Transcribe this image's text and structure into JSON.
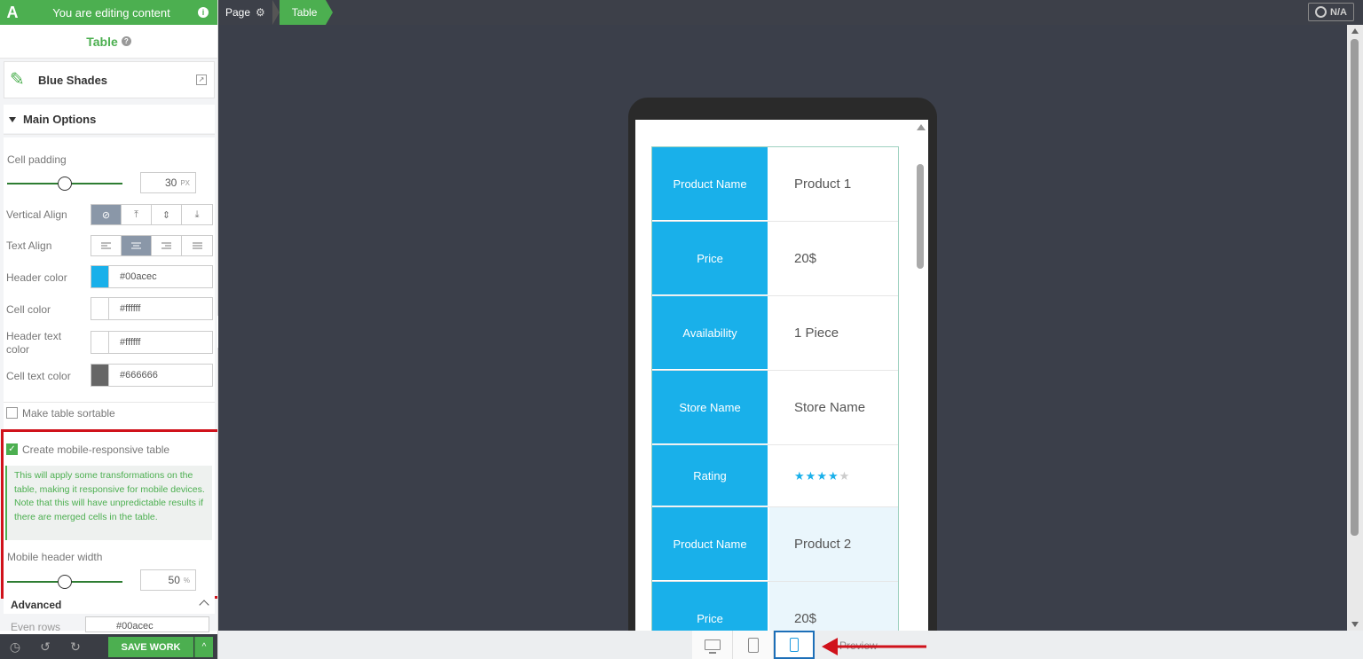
{
  "header": {
    "logo_letter": "A",
    "editing_label": "You are editing content",
    "info_icon": "info-icon"
  },
  "panel": {
    "title": "Table",
    "preset_name": "Blue Shades",
    "main_options_label": "Main Options",
    "cell_padding": {
      "label": "Cell padding",
      "value": "30",
      "unit": "PX",
      "slider_fraction": 0.5
    },
    "vertical_align": {
      "label": "Vertical Align",
      "options": [
        "⊘",
        "⤒",
        "⇕",
        "⤓"
      ],
      "active_index": 0
    },
    "text_align": {
      "label": "Text Align",
      "options": [
        "left",
        "center",
        "right",
        "justify"
      ],
      "active_index": 1
    },
    "header_color": {
      "label": "Header color",
      "value": "#00acec",
      "swatch": "#19b0ea"
    },
    "cell_color": {
      "label": "Cell color",
      "value": "#ffffff",
      "swatch": "#ffffff"
    },
    "header_text_color": {
      "label": "Header text color",
      "value": "#ffffff",
      "swatch": "#ffffff"
    },
    "cell_text_color": {
      "label": "Cell text color",
      "value": "#666666",
      "swatch": "#666666"
    },
    "sortable": {
      "label": "Make table sortable",
      "checked": false
    },
    "responsive": {
      "label": "Create mobile-responsive table",
      "checked": true
    },
    "responsive_note": "This will apply some transformations on the table, making it responsive for mobile devices. Note that this will have unpredictable results if there are merged cells in the table.",
    "mobile_header_width": {
      "label": "Mobile header width",
      "value": "50",
      "unit": "%",
      "slider_fraction": 0.5
    },
    "advanced_label": "Advanced",
    "even_rows": {
      "label": "Even rows",
      "value": "#00acec"
    }
  },
  "bottom_bar": {
    "save_label": "SAVE WORK",
    "history_icon": "clock-icon",
    "undo_icon": "undo-icon",
    "redo_icon": "redo-icon"
  },
  "topbar": {
    "page_label": "Page",
    "table_label": "Table",
    "na_label": "N/A"
  },
  "table": {
    "rows": [
      {
        "header": "Product Name",
        "value": "Product 1",
        "alt": false
      },
      {
        "header": "Price",
        "value": "20$",
        "alt": false
      },
      {
        "header": "Availability",
        "value": "1 Piece",
        "alt": false
      },
      {
        "header": "Store Name",
        "value": "Store Name",
        "alt": false
      },
      {
        "header": "Rating",
        "rating": 4,
        "rating_max": 5,
        "alt": false
      },
      {
        "header": "Product Name",
        "value": "Product 2",
        "alt": true
      },
      {
        "header": "Price",
        "value": "20$",
        "alt": true
      }
    ]
  },
  "device_bar": {
    "active": "mobile",
    "preview_label": "Preview"
  },
  "colors": {
    "accent": "#4caf50",
    "table_header": "#19b0ea",
    "annotation_red": "#d0121b"
  }
}
